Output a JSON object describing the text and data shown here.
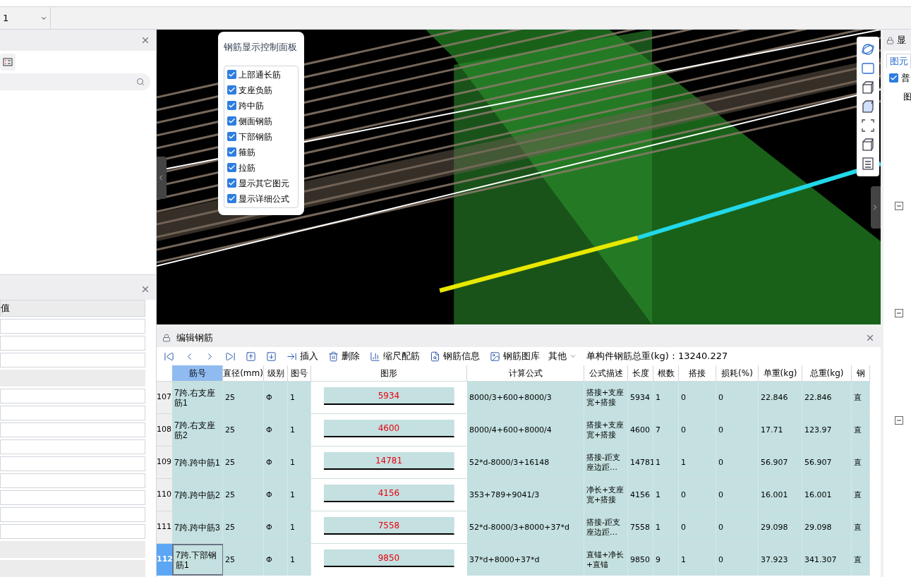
{
  "floor_select": {
    "value": "1"
  },
  "properties_panel": {
    "value_header": "值",
    "rows": [
      {
        "kind": "field"
      },
      {
        "kind": "field"
      },
      {
        "kind": "field"
      },
      {
        "kind": "group"
      },
      {
        "kind": "field"
      },
      {
        "kind": "field"
      },
      {
        "kind": "field"
      },
      {
        "kind": "field"
      },
      {
        "kind": "field"
      },
      {
        "kind": "field"
      },
      {
        "kind": "field"
      },
      {
        "kind": "field"
      },
      {
        "kind": "field"
      },
      {
        "kind": "group"
      },
      {
        "kind": "group"
      }
    ]
  },
  "rebar_panel": {
    "title": "钢筋显示控制面板",
    "options": [
      {
        "label": "上部通长筋",
        "checked": true
      },
      {
        "label": "支座负筋",
        "checked": true
      },
      {
        "label": "跨中筋",
        "checked": true
      },
      {
        "label": "侧面钢筋",
        "checked": true
      },
      {
        "label": "下部钢筋",
        "checked": true
      },
      {
        "label": "箍筋",
        "checked": true
      },
      {
        "label": "拉筋",
        "checked": true
      },
      {
        "label": "显示其它图元",
        "checked": true
      },
      {
        "label": "显示详细公式",
        "checked": true
      }
    ]
  },
  "edit_rebar": {
    "title": "编辑钢筋",
    "toolbar": [
      {
        "kind": "first"
      },
      {
        "kind": "prev"
      },
      {
        "kind": "next"
      },
      {
        "kind": "last"
      },
      {
        "kind": "up"
      },
      {
        "kind": "down"
      },
      {
        "kind": "insert",
        "label": "插入"
      },
      {
        "kind": "delete",
        "label": "删除"
      },
      {
        "kind": "scale",
        "label": "缩尺配筋"
      },
      {
        "kind": "info",
        "label": "钢筋信息"
      },
      {
        "kind": "library",
        "label": "钢筋图库"
      },
      {
        "kind": "menu",
        "label": "其他"
      }
    ],
    "total_label": "单构件钢筋总重(kg)：13240.227",
    "columns": [
      "筋号",
      "直径(mm)",
      "级别",
      "图号",
      "图形",
      "计算公式",
      "公式描述",
      "长度",
      "根数",
      "搭接",
      "损耗(%)",
      "单重(kg)",
      "总重(kg)",
      "钢"
    ],
    "rows": [
      {
        "num": "107",
        "selected": false,
        "cells": [
          "7跨.右支座筋1",
          "25",
          "Φ",
          "1",
          "5934",
          "8000/3+600+8000/3",
          "搭接+支座宽+搭接",
          "5934",
          "1",
          "0",
          "0",
          "22.846",
          "22.846",
          "直"
        ]
      },
      {
        "num": "108",
        "selected": false,
        "cells": [
          "7跨.右支座筋2",
          "25",
          "Φ",
          "1",
          "4600",
          "8000/4+600+8000/4",
          "搭接+支座宽+搭接",
          "4600",
          "7",
          "0",
          "0",
          "17.71",
          "123.97",
          "直"
        ]
      },
      {
        "num": "109",
        "selected": false,
        "cells": [
          "7跨.跨中筋1",
          "25",
          "Φ",
          "1",
          "14781",
          "52*d-8000/3+16148",
          "搭接-距支座边距…",
          "14781",
          "1",
          "1",
          "0",
          "56.907",
          "56.907",
          "直"
        ]
      },
      {
        "num": "110",
        "selected": false,
        "cells": [
          "7跨.跨中筋2",
          "25",
          "Φ",
          "1",
          "4156",
          "353+789+9041/3",
          "净长+支座宽+搭接",
          "4156",
          "1",
          "0",
          "0",
          "16.001",
          "16.001",
          "直"
        ]
      },
      {
        "num": "111",
        "selected": false,
        "cells": [
          "7跨.跨中筋3",
          "25",
          "Φ",
          "1",
          "7558",
          "52*d-8000/3+8000+37*d",
          "搭接-距支座边距…",
          "7558",
          "1",
          "0",
          "0",
          "29.098",
          "29.098",
          "直"
        ]
      },
      {
        "num": "112",
        "selected": true,
        "cells": [
          "7跨.下部钢筋1",
          "25",
          "Φ",
          "1",
          "9850",
          "37*d+8000+37*d",
          "直锚+净长+直锚",
          "9850",
          "9",
          "1",
          "0",
          "37.923",
          "341.307",
          "直"
        ]
      }
    ]
  },
  "right_panel": {
    "title": "显",
    "tab": "图元",
    "checkbox": {
      "label": "普",
      "checked": true
    },
    "column": "图",
    "groups": [
      {
        "expanded": true
      },
      {
        "expanded": true
      },
      {
        "expanded": true
      }
    ]
  }
}
